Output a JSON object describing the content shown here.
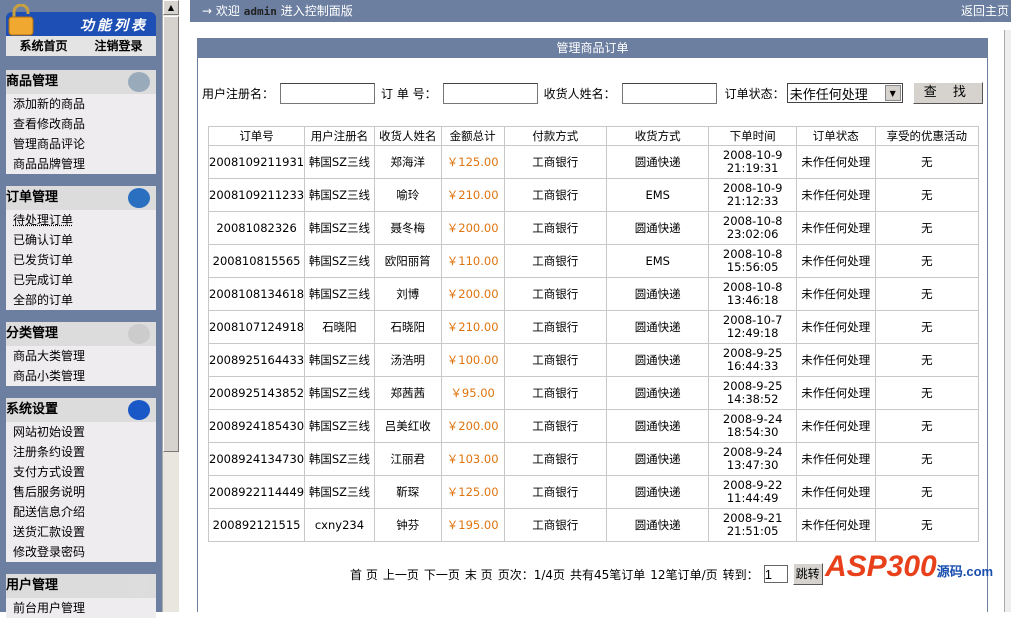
{
  "sidebar": {
    "header": "功能列表",
    "home": "系统首页",
    "logout": "注销登录",
    "sections": [
      {
        "title": "商品管理",
        "icon": "keyhole-icon",
        "items": [
          "添加新的商品",
          "查看修改商品",
          "管理商品评论",
          "商品品牌管理"
        ]
      },
      {
        "title": "订单管理",
        "icon": "globe-icon",
        "items": [
          "待处理订单",
          "已确认订单",
          "已发货订单",
          "已完成订单",
          "全部的订单"
        ]
      },
      {
        "title": "分类管理",
        "icon": "arrow-icon",
        "items": [
          "商品大类管理",
          "商品小类管理"
        ]
      },
      {
        "title": "系统设置",
        "icon": "magnifier-icon",
        "items": [
          "网站初始设置",
          "注册条约设置",
          "支付方式设置",
          "售后服务说明",
          "配送信息介绍",
          "送货汇款设置",
          "修改登录密码"
        ]
      },
      {
        "title": "用户管理",
        "icon": "compass-icon",
        "items": [
          "前台用户管理"
        ]
      }
    ]
  },
  "topbar": {
    "arrow": "→",
    "welcome": "欢迎",
    "user": "admin",
    "suffix": "进入控制面版",
    "home": "返回主页"
  },
  "panel": {
    "title": "管理商品订单"
  },
  "search": {
    "username_label": "用户注册名：",
    "order_label": "订 单 号：",
    "receiver_label": "收货人姓名：",
    "status_label": "订单状态：",
    "status_value": "未作任何处理",
    "button": "查 找"
  },
  "table": {
    "headers": [
      "订单号",
      "用户注册名",
      "收货人姓名",
      "金额总计",
      "付款方式",
      "收货方式",
      "下单时间",
      "订单状态",
      "享受的优惠活动"
    ],
    "rows": [
      [
        "2008109211931",
        "韩国SZ三线",
        "郑海洋",
        "￥125.00",
        "工商银行",
        "圆通快递",
        "2008-10-9",
        "21:19:31",
        "未作任何处理",
        "无"
      ],
      [
        "2008109211233",
        "韩国SZ三线",
        "喻玲",
        "￥210.00",
        "工商银行",
        "EMS",
        "2008-10-9",
        "21:12:33",
        "未作任何处理",
        "无"
      ],
      [
        "20081082326",
        "韩国SZ三线",
        "聂冬梅",
        "￥200.00",
        "工商银行",
        "圆通快递",
        "2008-10-8",
        "23:02:06",
        "未作任何处理",
        "无"
      ],
      [
        "200810815565",
        "韩国SZ三线",
        "欧阳丽筲",
        "￥110.00",
        "工商银行",
        "EMS",
        "2008-10-8",
        "15:56:05",
        "未作任何处理",
        "无"
      ],
      [
        "2008108134618",
        "韩国SZ三线",
        "刘博",
        "￥200.00",
        "工商银行",
        "圆通快递",
        "2008-10-8",
        "13:46:18",
        "未作任何处理",
        "无"
      ],
      [
        "2008107124918",
        "石晓阳",
        "石晓阳",
        "￥210.00",
        "工商银行",
        "圆通快递",
        "2008-10-7",
        "12:49:18",
        "未作任何处理",
        "无"
      ],
      [
        "2008925164433",
        "韩国SZ三线",
        "汤浩明",
        "￥100.00",
        "工商银行",
        "圆通快递",
        "2008-9-25",
        "16:44:33",
        "未作任何处理",
        "无"
      ],
      [
        "2008925143852",
        "韩国SZ三线",
        "郑茜茜",
        "￥95.00",
        "工商银行",
        "圆通快递",
        "2008-9-25",
        "14:38:52",
        "未作任何处理",
        "无"
      ],
      [
        "2008924185430",
        "韩国SZ三线",
        "吕美红收",
        "￥200.00",
        "工商银行",
        "圆通快递",
        "2008-9-24",
        "18:54:30",
        "未作任何处理",
        "无"
      ],
      [
        "2008924134730",
        "韩国SZ三线",
        "江丽君",
        "￥103.00",
        "工商银行",
        "圆通快递",
        "2008-9-24",
        "13:47:30",
        "未作任何处理",
        "无"
      ],
      [
        "2008922114449",
        "韩国SZ三线",
        "靳琛",
        "￥125.00",
        "工商银行",
        "圆通快递",
        "2008-9-22",
        "11:44:49",
        "未作任何处理",
        "无"
      ],
      [
        "200892121515",
        "cxny234",
        "钟芬",
        "￥195.00",
        "工商银行",
        "圆通快递",
        "2008-9-21",
        "21:51:05",
        "未作任何处理",
        "无"
      ]
    ]
  },
  "pager": {
    "first": "首 页",
    "prev": "上一页",
    "next": "下一页",
    "last": "末 页",
    "page_info": "页次：1/4页",
    "total": "共有45笔订单",
    "per_page": "12笔订单/页",
    "goto_label": "转到：",
    "goto_value": "1",
    "goto_button": "跳转"
  },
  "watermark": {
    "text": "ASP300",
    "sub": "源码.com"
  }
}
